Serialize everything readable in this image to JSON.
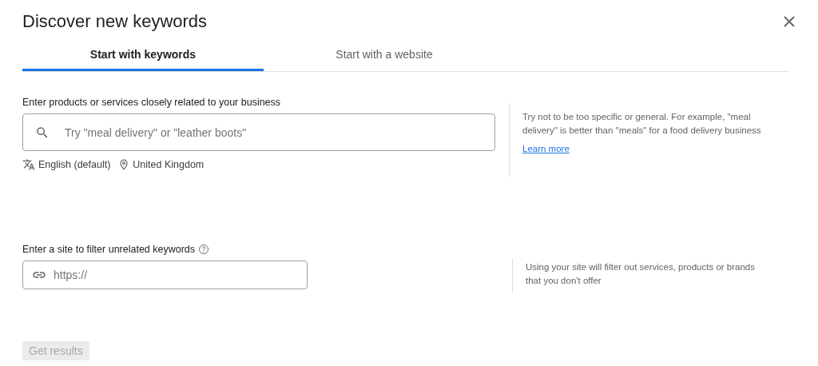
{
  "dialog": {
    "title": "Discover new keywords"
  },
  "tabs": [
    {
      "label": "Start with keywords",
      "selected": true
    },
    {
      "label": "Start with a website",
      "selected": false
    }
  ],
  "sections": [
    {
      "kind": "keywords",
      "label": "Enter products or services closely related to your business",
      "field": {
        "placeholder": "Try \"meal delivery\" or \"leather boots\""
      },
      "language": "English (default)",
      "location": "United Kingdom",
      "help": {
        "text": "Try not to be too specific or general. For example, \"meal delivery\" is better than \"meals\" for a food delivery business",
        "link": "Learn more"
      }
    },
    {
      "kind": "site",
      "label": "Enter a site to filter unrelated keywords",
      "field": {
        "placeholder": "https://"
      },
      "help": {
        "text": "Using your site will filter out services, products or brands that you don't offer"
      }
    }
  ],
  "button": {
    "label": "Get results",
    "disabled": true
  }
}
